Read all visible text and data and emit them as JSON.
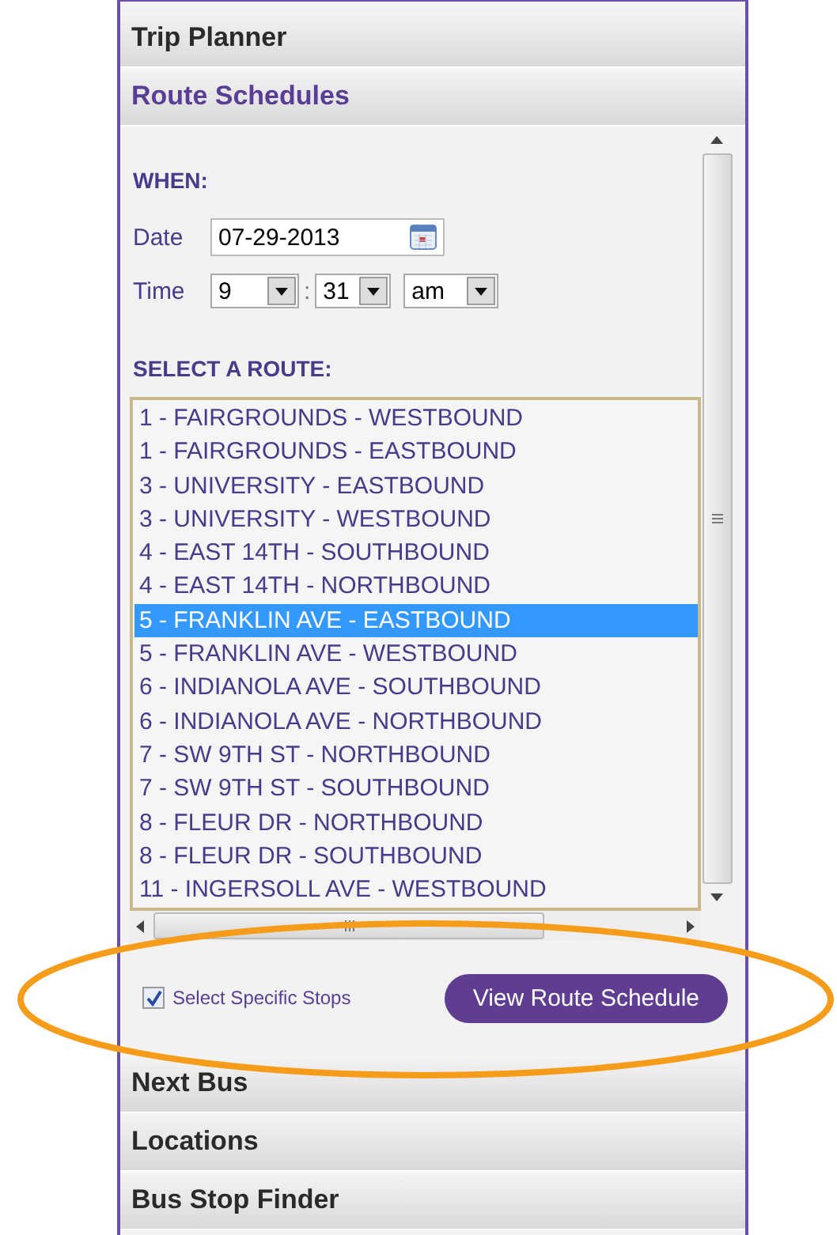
{
  "sections_top": [
    {
      "label": "Trip Planner",
      "expanded": false
    },
    {
      "label": "Route Schedules",
      "expanded": true
    }
  ],
  "when_heading": "WHEN:",
  "date": {
    "label": "Date",
    "value": "07-29-2013"
  },
  "time": {
    "label": "Time",
    "hour": "9",
    "separator": ":",
    "minute": "31",
    "meridiem": "am"
  },
  "route_heading": "SELECT A ROUTE:",
  "routes": [
    {
      "label": "1 - FAIRGROUNDS - WESTBOUND",
      "selected": false
    },
    {
      "label": "1 - FAIRGROUNDS - EASTBOUND",
      "selected": false
    },
    {
      "label": "3 - UNIVERSITY - EASTBOUND",
      "selected": false
    },
    {
      "label": "3 - UNIVERSITY - WESTBOUND",
      "selected": false
    },
    {
      "label": "4 - EAST 14TH - SOUTHBOUND",
      "selected": false
    },
    {
      "label": "4 - EAST 14TH - NORTHBOUND",
      "selected": false
    },
    {
      "label": "5 - FRANKLIN AVE - EASTBOUND",
      "selected": true
    },
    {
      "label": "5 - FRANKLIN AVE - WESTBOUND",
      "selected": false
    },
    {
      "label": "6 - INDIANOLA AVE - SOUTHBOUND",
      "selected": false
    },
    {
      "label": "6 - INDIANOLA AVE - NORTHBOUND",
      "selected": false
    },
    {
      "label": "7 - SW 9TH ST - NORTHBOUND",
      "selected": false
    },
    {
      "label": "7 - SW 9TH ST - SOUTHBOUND",
      "selected": false
    },
    {
      "label": "8 - FLEUR DR - NORTHBOUND",
      "selected": false
    },
    {
      "label": "8 - FLEUR DR - SOUTHBOUND",
      "selected": false
    },
    {
      "label": "11 - INGERSOLL AVE - WESTBOUND",
      "selected": false
    }
  ],
  "specific_stops": {
    "label": "Select Specific Stops",
    "checked": true
  },
  "view_button": "View Route Schedule",
  "sections_bottom": [
    {
      "label": "Next Bus",
      "expanded": false
    },
    {
      "label": "Locations",
      "expanded": false
    },
    {
      "label": "Bus Stop Finder",
      "expanded": false
    }
  ]
}
